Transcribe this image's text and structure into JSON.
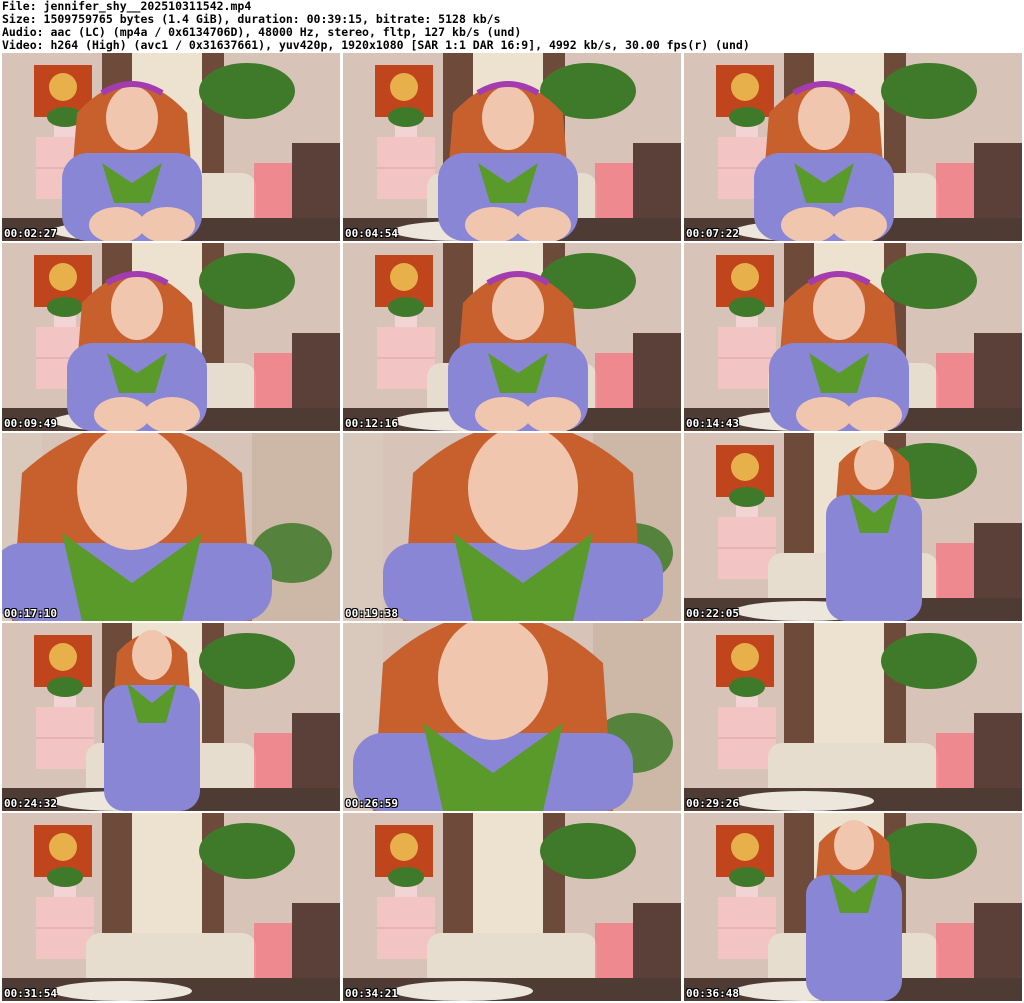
{
  "header": {
    "file": "File: jennifer_shy__202510311542.mp4",
    "size": "Size: 1509759765 bytes (1.4 GiB), duration: 00:39:15, bitrate: 5128 kb/s",
    "audio": "Audio: aac (LC) (mp4a / 0x6134706D), 48000 Hz, stereo, fltp, 127 kb/s (und)",
    "video": "Video: h264 (High) (avc1 / 0x31637661), yuv420p, 1920x1080 [SAR 1:1 DAR 16:9], 4992 kb/s, 30.00 fps(r) (und)"
  },
  "colors": {
    "wall": "#d8c3b8",
    "curtain": "#6e4a3a",
    "sweater": "#8a86d6",
    "scarf": "#5a9a2a",
    "hair": "#c8602e",
    "headband": "#a23cb0",
    "skin": "#f0c6ae",
    "dresser": "#f2c4c4",
    "plant": "#3f7a2a",
    "sofa": "#e6ddcf",
    "floor": "#4e3b34",
    "poster": "#c0441c",
    "glow": "#ff5a6e"
  },
  "thumbnails": [
    {
      "time": "00:02:27"
    },
    {
      "time": "00:04:54"
    },
    {
      "time": "00:07:22"
    },
    {
      "time": "00:09:49"
    },
    {
      "time": "00:12:16"
    },
    {
      "time": "00:14:43"
    },
    {
      "time": "00:17:10"
    },
    {
      "time": "00:19:38"
    },
    {
      "time": "00:22:05"
    },
    {
      "time": "00:24:32"
    },
    {
      "time": "00:26:59"
    },
    {
      "time": "00:29:26"
    },
    {
      "time": "00:31:54"
    },
    {
      "time": "00:34:21"
    },
    {
      "time": "00:36:48"
    }
  ]
}
